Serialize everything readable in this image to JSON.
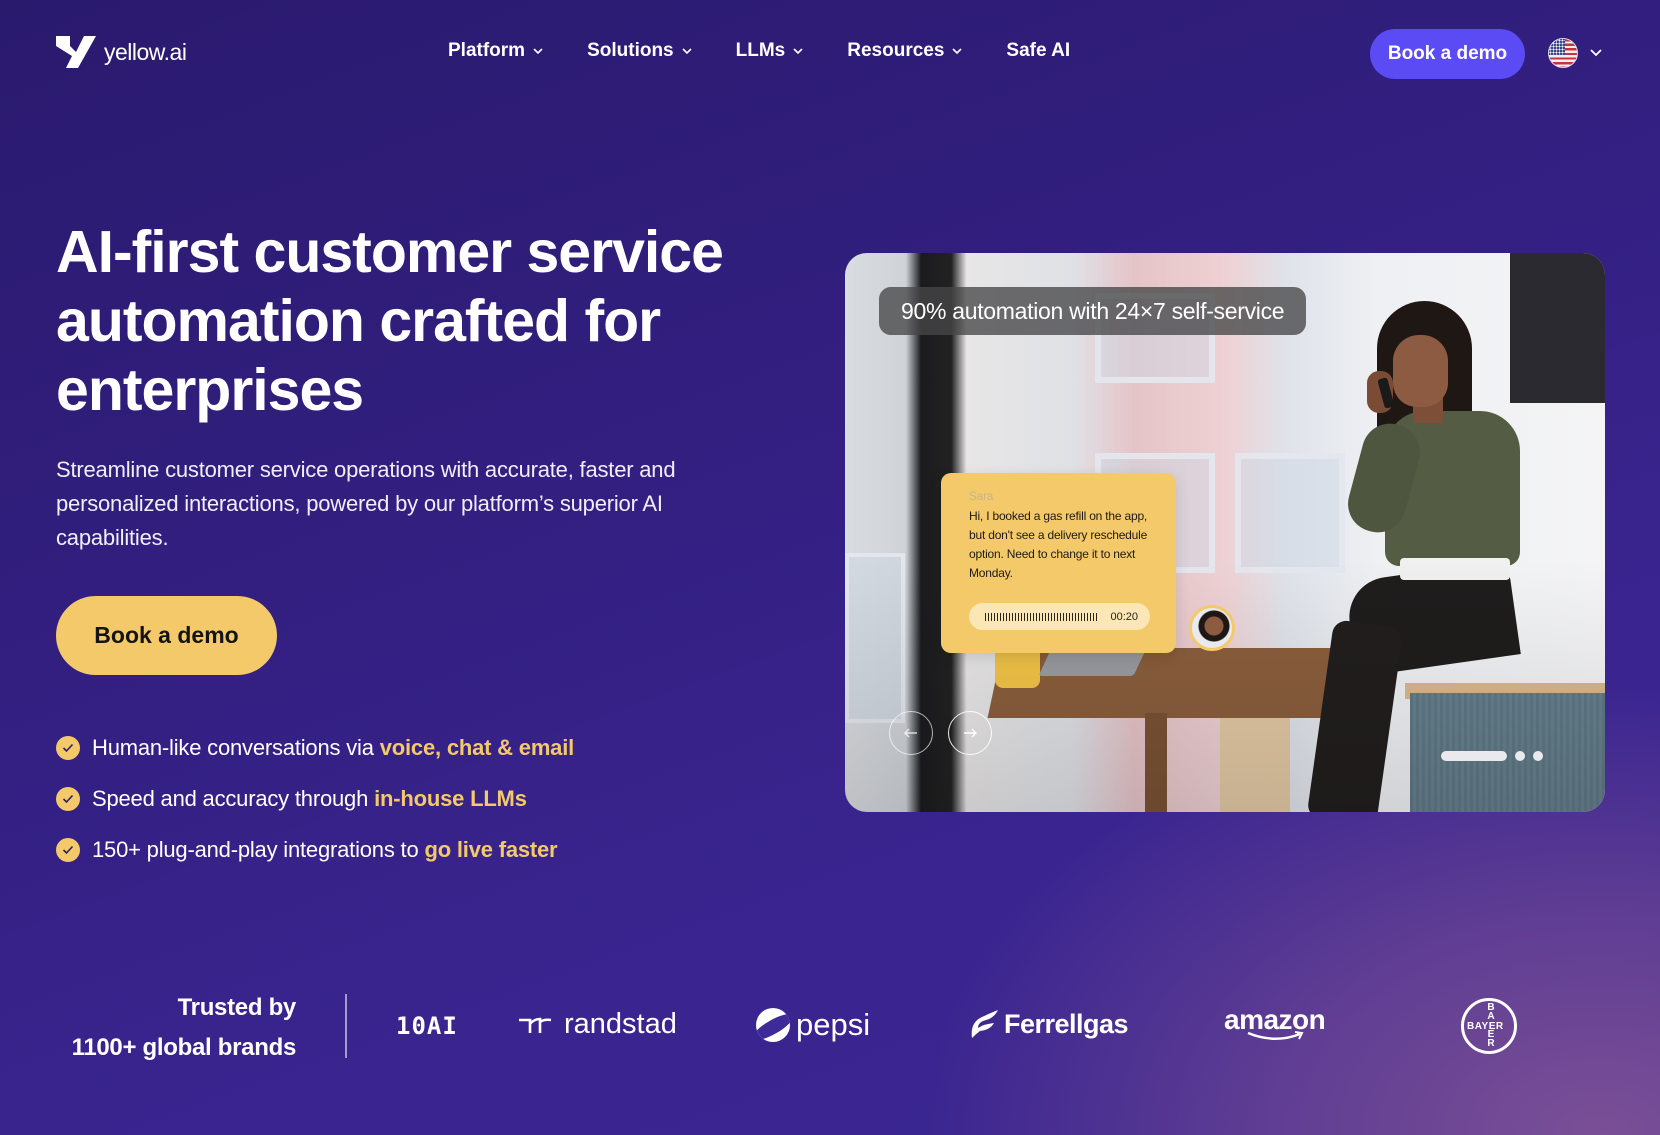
{
  "nav": {
    "logo_text": "yellow.ai",
    "items": [
      {
        "label": "Platform",
        "has_dropdown": true
      },
      {
        "label": "Solutions",
        "has_dropdown": true
      },
      {
        "label": "LLMs",
        "has_dropdown": true
      },
      {
        "label": "Resources",
        "has_dropdown": true
      },
      {
        "label": "Safe AI",
        "has_dropdown": false
      }
    ],
    "cta_label": "Book a demo",
    "locale_icon": "us-flag-icon"
  },
  "hero": {
    "title": "AI-first customer service automation crafted for enterprises",
    "subtitle": "Streamline customer service operations with accurate, faster and personalized interactions, powered by our platform’s superior AI capabilities.",
    "cta_label": "Book a demo",
    "features": [
      {
        "text": "Human-like conversations via",
        "highlight": "voice, chat & email"
      },
      {
        "text": "Speed and accuracy through",
        "highlight": "in-house LLMs"
      },
      {
        "text": "150+ plug-and-play integrations to",
        "highlight": "go live faster"
      }
    ]
  },
  "media": {
    "badge": "90% automation with 24×7 self-service",
    "chat": {
      "name": "Sara",
      "message": "Hi, I booked a gas refill on the app, but don't see a delivery reschedule option. Need to change it to next Monday.",
      "audio_duration": "00:20"
    },
    "carousel": {
      "total_slides": 3,
      "active_slide": 1
    }
  },
  "trusted": {
    "line1": "Trusted by",
    "line2": "1100+ global brands",
    "brands": [
      "10AI",
      "randstad",
      "pepsi",
      "Ferrellgas",
      "amazon",
      "BAYER"
    ]
  },
  "colors": {
    "background": "#321f80",
    "accent_yellow": "#f4c96a",
    "nav_cta": "#5b4bf5"
  }
}
